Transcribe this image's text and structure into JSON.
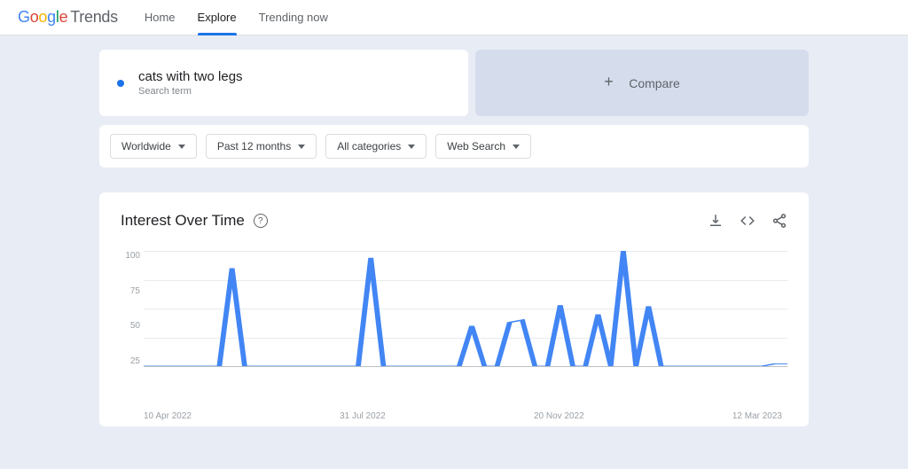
{
  "logo": {
    "word1_letters": [
      "G",
      "o",
      "o",
      "g",
      "l",
      "e"
    ],
    "word2": "Trends"
  },
  "nav": {
    "home": "Home",
    "explore": "Explore",
    "trending": "Trending now"
  },
  "topic": {
    "term": "cats with two legs",
    "subtitle": "Search term"
  },
  "compare": {
    "label": "Compare"
  },
  "filters": {
    "region": "Worldwide",
    "time": "Past 12 months",
    "category": "All categories",
    "search_type": "Web Search"
  },
  "panel": {
    "title": "Interest Over Time"
  },
  "chart_data": {
    "type": "line",
    "title": "Interest Over Time",
    "xlabel": "",
    "ylabel": "",
    "ylim": [
      0,
      100
    ],
    "y_ticks": [
      25,
      50,
      75,
      100
    ],
    "x_tick_labels": [
      "10 Apr 2022",
      "31 Jul 2022",
      "20 Nov 2022",
      "12 Mar 2023"
    ],
    "x": [
      0,
      1,
      2,
      3,
      4,
      5,
      6,
      7,
      8,
      9,
      10,
      11,
      12,
      13,
      14,
      15,
      16,
      17,
      18,
      19,
      20,
      21,
      22,
      23,
      24,
      25,
      26,
      27,
      28,
      29,
      30,
      31,
      32,
      33,
      34,
      35,
      36,
      37,
      38,
      39,
      40,
      41,
      42,
      43,
      44,
      45,
      46,
      47,
      48,
      49,
      50,
      51
    ],
    "values": [
      0,
      0,
      0,
      0,
      0,
      0,
      0,
      85,
      0,
      0,
      0,
      0,
      0,
      0,
      0,
      0,
      0,
      0,
      94,
      0,
      0,
      0,
      0,
      0,
      0,
      0,
      35,
      0,
      0,
      38,
      40,
      0,
      0,
      53,
      0,
      0,
      45,
      0,
      100,
      0,
      52,
      0,
      0,
      0,
      0,
      0,
      0,
      0,
      0,
      0,
      2,
      2
    ]
  }
}
